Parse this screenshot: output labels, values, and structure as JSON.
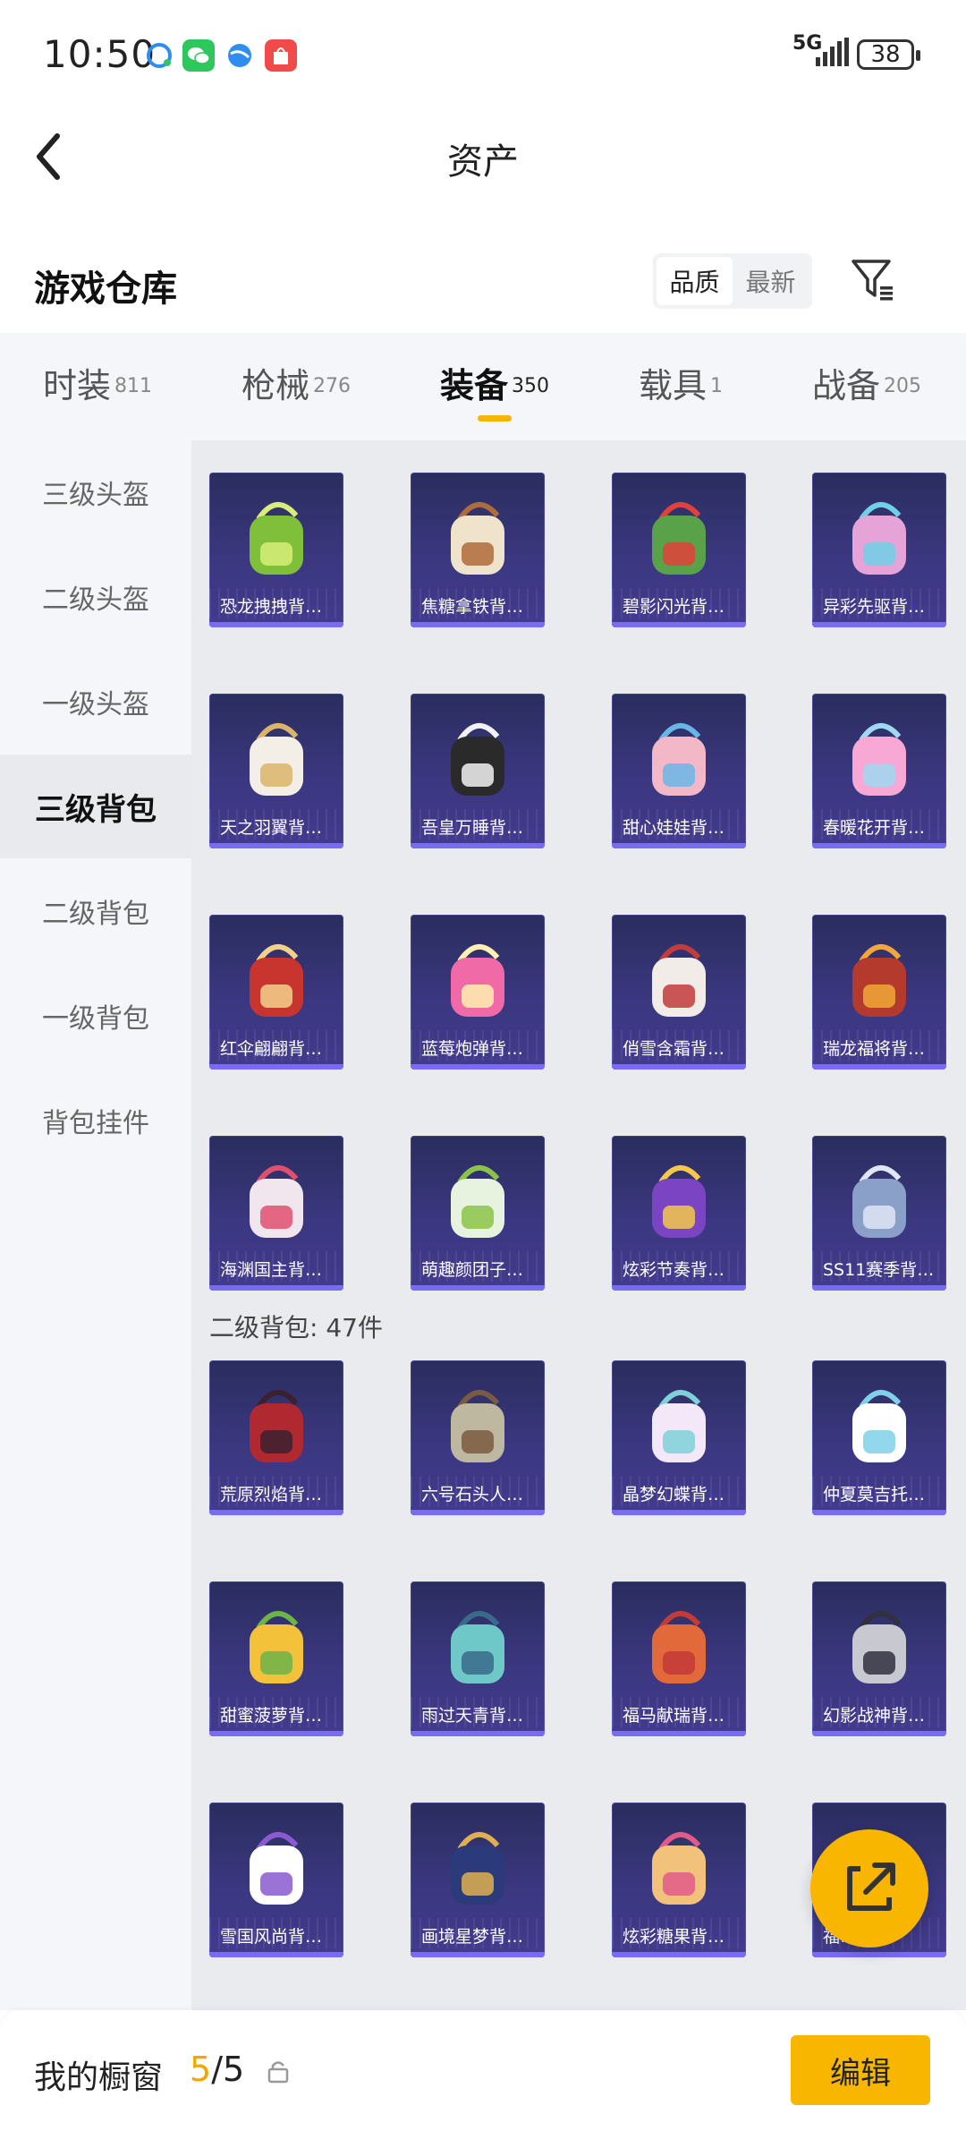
{
  "status_bar": {
    "time": "10:50",
    "network": "5G",
    "battery": "38",
    "app_icons": [
      "chat-bubble-icon",
      "wechat-icon",
      "browser-icon",
      "shop-bag-icon"
    ]
  },
  "header": {
    "title": "资产"
  },
  "section": {
    "title": "游戏仓库",
    "sort_options": [
      "品质",
      "最新"
    ],
    "sort_active": "品质"
  },
  "tabs": [
    {
      "label": "时装",
      "count": "811"
    },
    {
      "label": "枪械",
      "count": "276"
    },
    {
      "label": "装备",
      "count": "350"
    },
    {
      "label": "载具",
      "count": "1"
    },
    {
      "label": "战备",
      "count": "205"
    }
  ],
  "active_tab": "装备",
  "sidebar": {
    "items": [
      {
        "label": "三级头盔"
      },
      {
        "label": "二级头盔"
      },
      {
        "label": "一级头盔"
      },
      {
        "label": "三级背包"
      },
      {
        "label": "二级背包"
      },
      {
        "label": "一级背包"
      },
      {
        "label": "背包挂件"
      }
    ],
    "active": "三级背包"
  },
  "groups": [
    {
      "items": [
        {
          "name": "恐龙拽拽背…",
          "color": "#7fbf3a",
          "accent": "#d7ee7a"
        },
        {
          "name": "焦糖拿铁背…",
          "color": "#f0e3cc",
          "accent": "#b06b3a"
        },
        {
          "name": "碧影闪光背…",
          "color": "#5aa24a",
          "accent": "#e2413a"
        },
        {
          "name": "异彩先驱背…",
          "color": "#e6a3d8",
          "accent": "#6fd0e8"
        },
        {
          "name": "天之羽翼背…",
          "color": "#f3efe6",
          "accent": "#d9b46a"
        },
        {
          "name": "吾皇万睡背…",
          "color": "#2a2a2a",
          "accent": "#f2f2f2"
        },
        {
          "name": "甜心娃娃背…",
          "color": "#f3b8c8",
          "accent": "#69b6e6"
        },
        {
          "name": "春暖花开背…",
          "color": "#f7a8d4",
          "accent": "#9fd8f0"
        },
        {
          "name": "红伞翩翩背…",
          "color": "#c7352e",
          "accent": "#f3d08a"
        },
        {
          "name": "蓝莓炮弹背…",
          "color": "#f06aa8",
          "accent": "#fff0b0"
        },
        {
          "name": "俏雪含霜背…",
          "color": "#f2ece8",
          "accent": "#c33b3b"
        },
        {
          "name": "瑞龙福将背…",
          "color": "#b33a2c",
          "accent": "#f0a838"
        },
        {
          "name": "海渊国主背…",
          "color": "#f2e6ee",
          "accent": "#e0506e"
        },
        {
          "name": "萌趣颜团子…",
          "color": "#e8f3df",
          "accent": "#8bc34a"
        },
        {
          "name": "炫彩节奏背…",
          "color": "#7a44c2",
          "accent": "#f5c84a"
        },
        {
          "name": "SS11赛季背…",
          "color": "#8aa0c8",
          "accent": "#dfe6f5"
        }
      ]
    },
    {
      "label": "二级背包: 47件",
      "items": [
        {
          "name": "荒原烈焰背…",
          "color": "#b02830",
          "accent": "#3b2030"
        },
        {
          "name": "六号石头人…",
          "color": "#bfb8a0",
          "accent": "#7a5a40"
        },
        {
          "name": "晶梦幻蝶背…",
          "color": "#f2e8f8",
          "accent": "#7fd0d8"
        },
        {
          "name": "仲夏莫吉托…",
          "color": "#ffffff",
          "accent": "#7fd0e8"
        },
        {
          "name": "甜蜜菠萝背…",
          "color": "#f3c23a",
          "accent": "#6bb34a"
        },
        {
          "name": "雨过天青背…",
          "color": "#6fc8c8",
          "accent": "#3a6a8a"
        },
        {
          "name": "福马献瑞背…",
          "color": "#e26a3a",
          "accent": "#c23a3a"
        },
        {
          "name": "幻影战神背…",
          "color": "#c8c8d0",
          "accent": "#303040"
        },
        {
          "name": "雪国风尚背…",
          "color": "#ffffff",
          "accent": "#8a5ad0"
        },
        {
          "name": "画境星梦背…",
          "color": "#2a3a7a",
          "accent": "#e0b050"
        },
        {
          "name": "炫彩糖果背…",
          "color": "#f3c27a",
          "accent": "#e05a8a"
        },
        {
          "name": "福…背…",
          "color": "#e07a8a",
          "accent": "#f0c060"
        }
      ]
    }
  ],
  "fab": {
    "icon": "share-external-icon"
  },
  "footer": {
    "label": "我的橱窗",
    "count_current": "5",
    "count_total": "/5",
    "edit_label": "编辑"
  },
  "colors": {
    "accent": "#f8b600",
    "card_bg": "#3b3780"
  }
}
